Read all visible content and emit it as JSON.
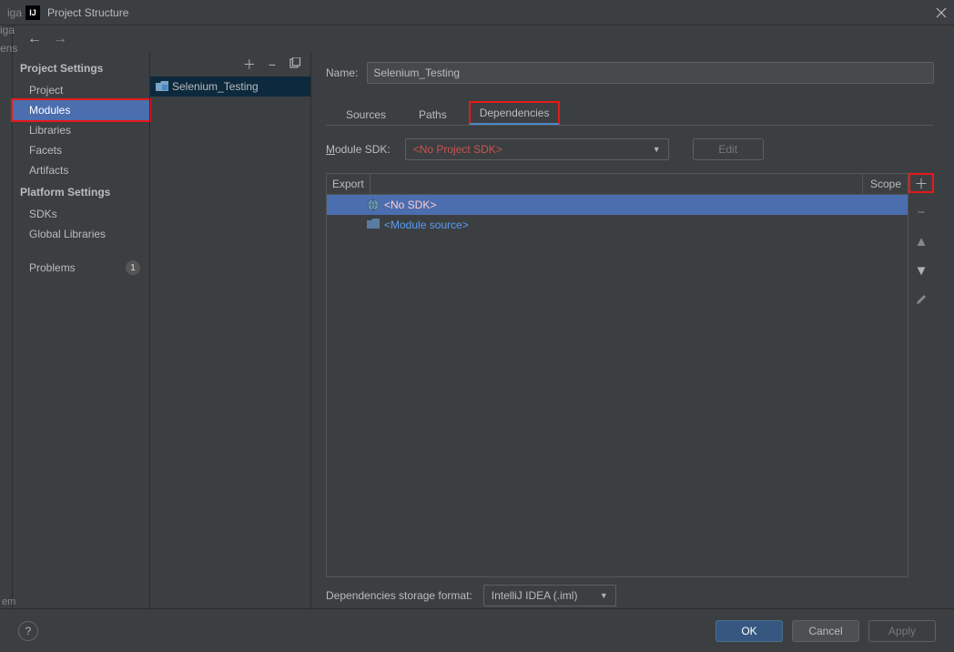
{
  "titlebar": {
    "left_fragment": "iga",
    "title": "Project Structure",
    "icon_label": "IJ"
  },
  "nav": {
    "back_enabled": true,
    "forward_enabled": false
  },
  "sidebar": {
    "project_settings_label": "Project Settings",
    "project": "Project",
    "modules": "Modules",
    "libraries": "Libraries",
    "facets": "Facets",
    "artifacts": "Artifacts",
    "platform_settings_label": "Platform Settings",
    "sdks": "SDKs",
    "global_libraries": "Global Libraries",
    "problems": "Problems",
    "problems_count": "1"
  },
  "modules_list": {
    "items": [
      "Selenium_Testing"
    ]
  },
  "left_fragment_below": "ens",
  "left_fragment_bottom": "em",
  "detail": {
    "name_label": "Name:",
    "name_value": "Selenium_Testing",
    "tabs": {
      "sources": "Sources",
      "paths": "Paths",
      "dependencies": "Dependencies"
    },
    "sdk_label_pre": "M",
    "sdk_label_post": "odule SDK:",
    "sdk_value": "<No Project SDK>",
    "edit_label": "Edit",
    "table": {
      "export": "Export",
      "scope": "Scope"
    },
    "deps": {
      "no_sdk": "<No SDK>",
      "module_source": "<Module source>"
    },
    "storage_label": "Dependencies storage format:",
    "storage_value": "IntelliJ IDEA (.iml)"
  },
  "footer": {
    "ok": "OK",
    "cancel": "Cancel",
    "apply": "Apply"
  }
}
